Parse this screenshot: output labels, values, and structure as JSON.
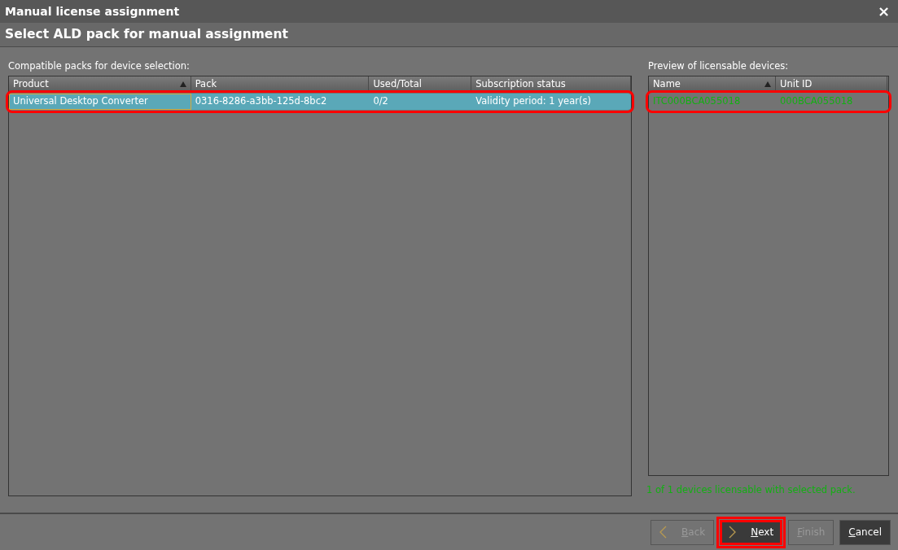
{
  "window": {
    "title": "Manual license assignment",
    "close": "×"
  },
  "subtitle": "Select ALD pack for manual assignment",
  "packs": {
    "label": "Compatible packs for device selection:",
    "columns": [
      {
        "label": "Product",
        "sorted": true
      },
      {
        "label": "Pack",
        "sorted": false
      },
      {
        "label": "Used/Total",
        "sorted": false
      },
      {
        "label": "Subscription status",
        "sorted": false
      }
    ],
    "rows": [
      {
        "selected": true,
        "highlighted": true,
        "cells": [
          "Universal Desktop Converter",
          "0316-8286-a3bb-125d-8bc2",
          "0/2",
          "Validity period: 1 year(s)"
        ]
      }
    ]
  },
  "devices": {
    "label": "Preview of licensable devices:",
    "columns": [
      {
        "label": "Name",
        "sorted": true
      },
      {
        "label": "Unit ID",
        "sorted": false
      }
    ],
    "rows": [
      {
        "highlighted": true,
        "cells": [
          "ITC000BCA055018",
          "000BCA055018"
        ]
      }
    ],
    "summary": "1 of 1 devices licensable with selected pack."
  },
  "buttons": [
    {
      "label": "Back",
      "kind": "back",
      "disabled": true,
      "highlighted": false
    },
    {
      "label": "Next",
      "kind": "next",
      "disabled": false,
      "highlighted": true
    },
    {
      "label": "Finish",
      "kind": "plain",
      "disabled": true,
      "highlighted": false
    },
    {
      "label": "Cancel",
      "kind": "plain",
      "disabled": false,
      "highlighted": false
    }
  ]
}
